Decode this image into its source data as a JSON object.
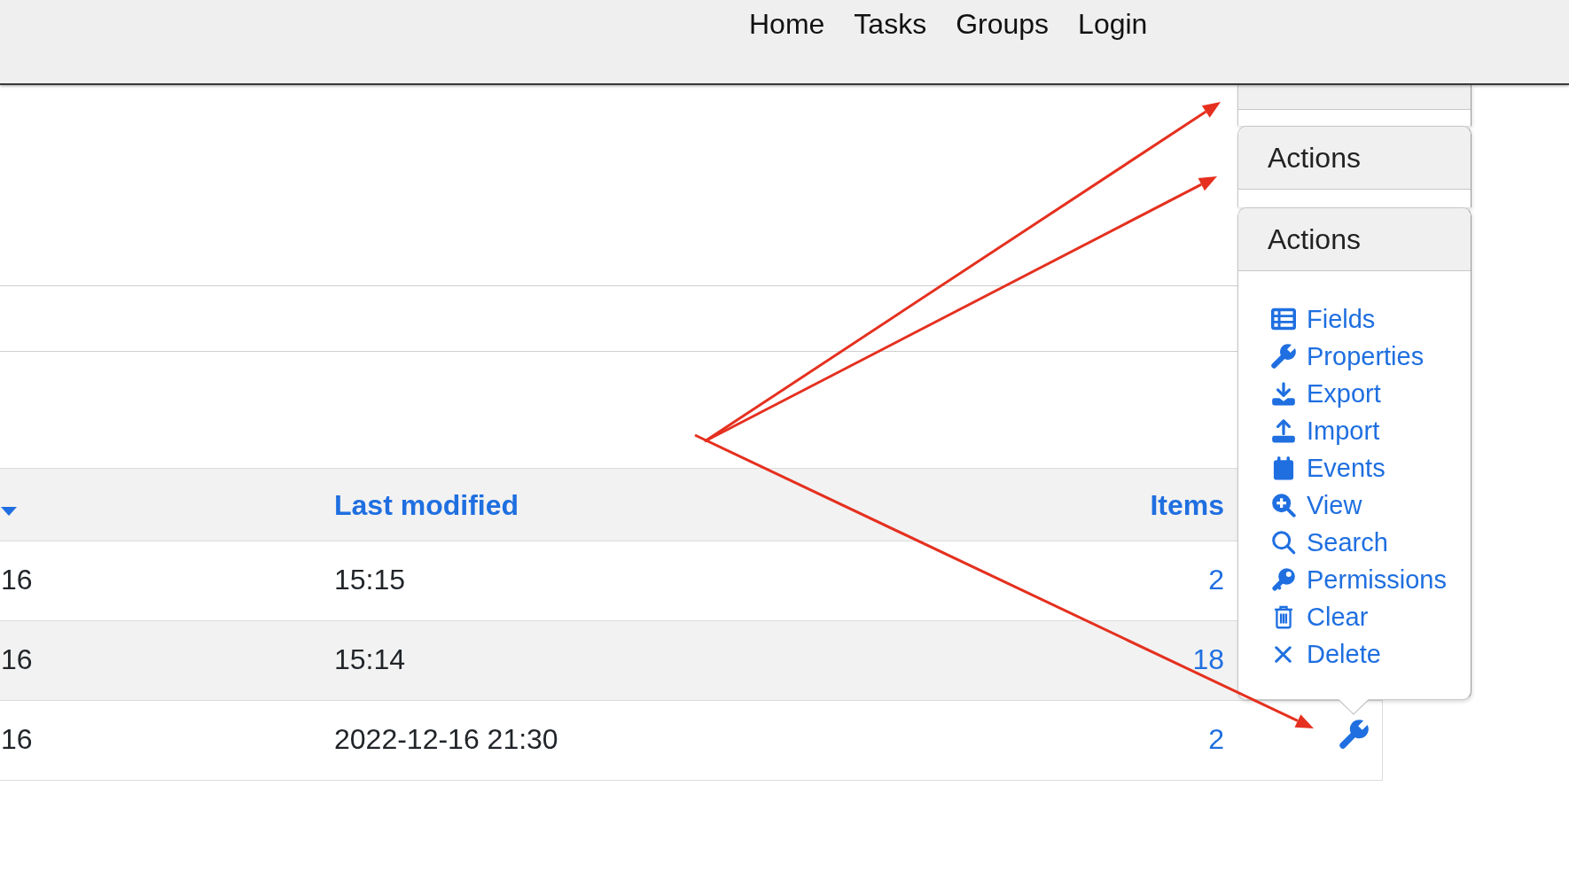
{
  "nav": {
    "links": [
      "Home",
      "Tasks",
      "Groups",
      "Login"
    ]
  },
  "table": {
    "columns": [
      {
        "sorted": true
      },
      {
        "label": "Last modified",
        "sorted": false
      },
      {
        "label": "Items",
        "sorted": false
      }
    ],
    "rows": [
      {
        "column_1": "16",
        "last_modified": "15:15",
        "items": "2",
        "action_button": false
      },
      {
        "column_1": "16",
        "last_modified": "15:14",
        "items": "18",
        "action_button": false
      },
      {
        "column_1": "16",
        "last_modified": "2022-12-16 21:30",
        "items": "2",
        "action_button": true
      }
    ]
  },
  "action_popovers": [
    {
      "kind": "covered"
    },
    {
      "kind": "collapsed",
      "title": "Actions"
    },
    {
      "kind": "menu",
      "title": "Actions",
      "items": [
        "Fields",
        "Properties",
        "Export",
        "Import",
        "Events",
        "View",
        "Search",
        "Permissions",
        "Clear",
        "Delete"
      ]
    }
  ]
}
